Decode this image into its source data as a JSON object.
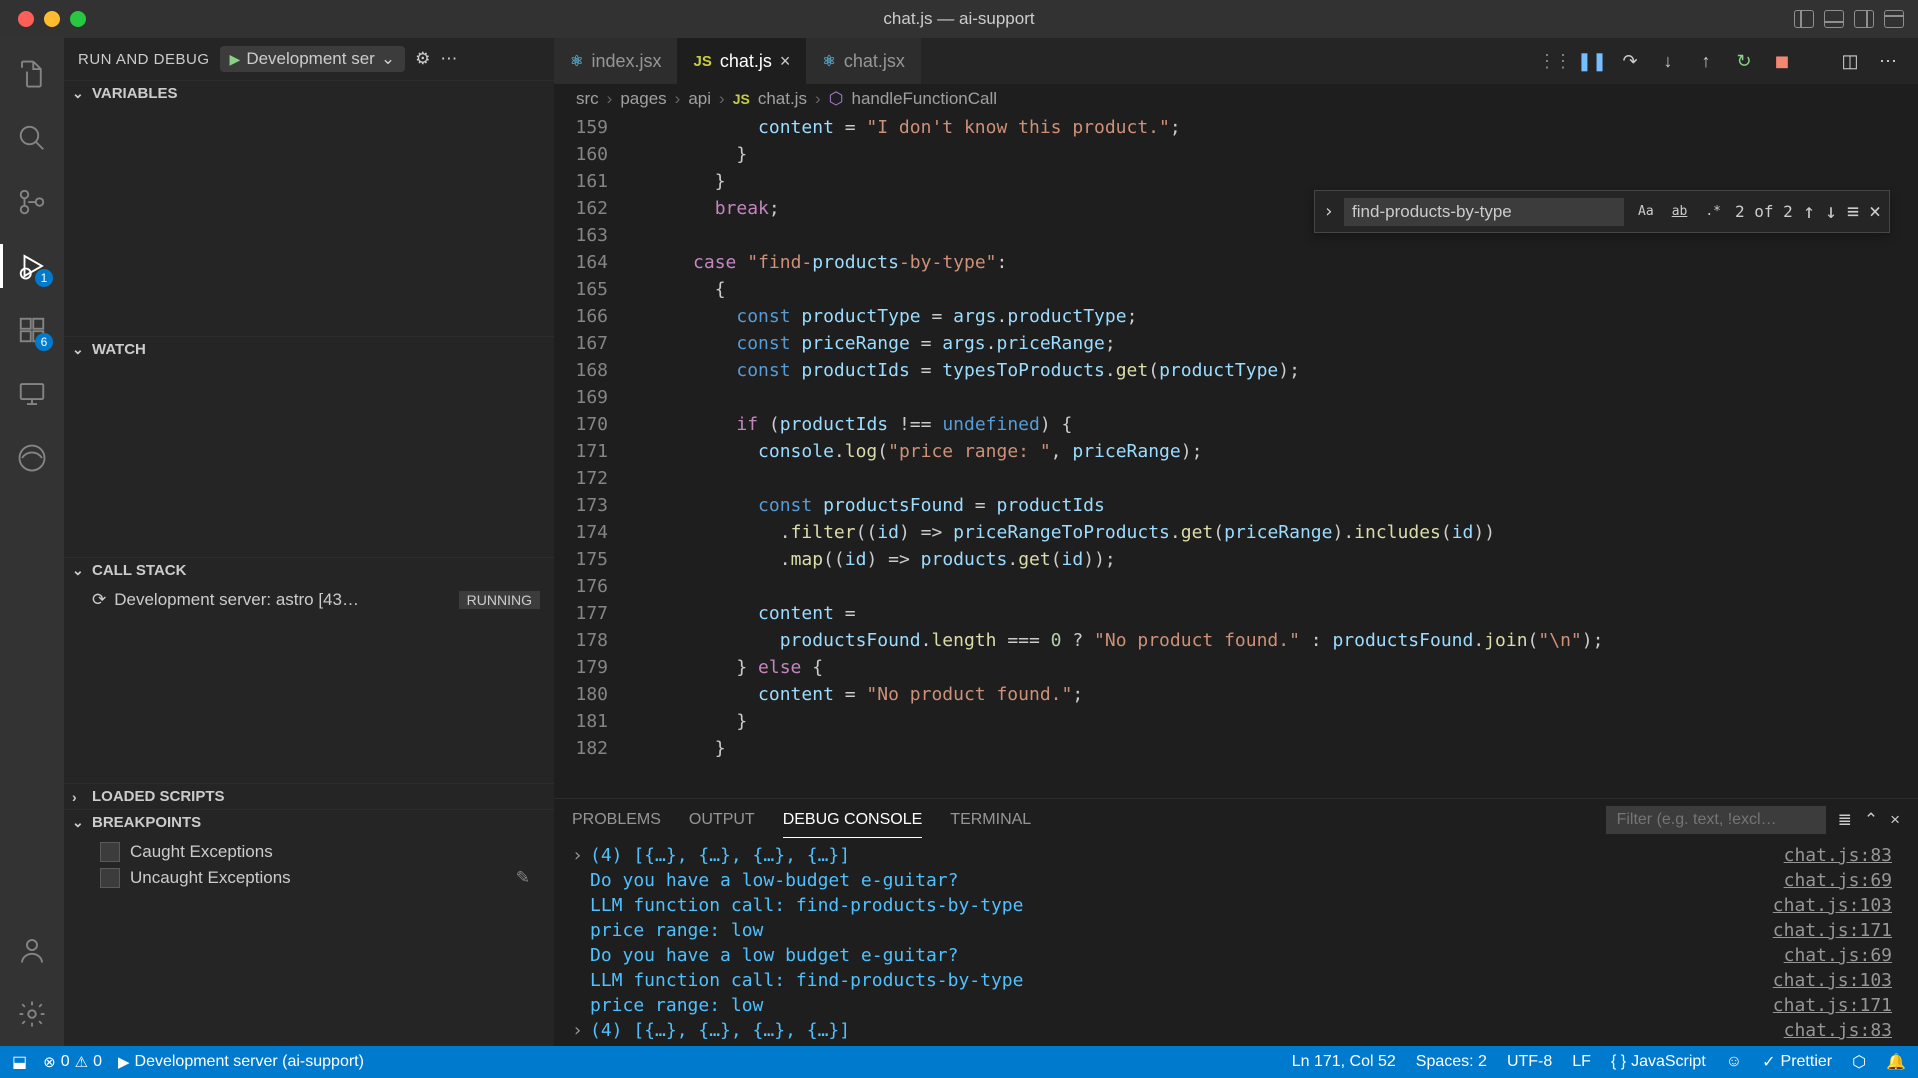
{
  "window": {
    "title": "chat.js — ai-support"
  },
  "sidebar": {
    "title": "RUN AND DEBUG",
    "config": "Development ser",
    "sections": {
      "variables": "VARIABLES",
      "watch": "WATCH",
      "callstack": "CALL STACK",
      "loaded": "LOADED SCRIPTS",
      "breakpoints": "BREAKPOINTS"
    },
    "callstackItem": "Development server: astro [43…",
    "callstackStatus": "RUNNING",
    "bp1": "Caught Exceptions",
    "bp2": "Uncaught Exceptions"
  },
  "activity": {
    "debugBadge": "1",
    "extBadge": "6"
  },
  "tabs": {
    "t1": "index.jsx",
    "t2": "chat.js",
    "t3": "chat.jsx"
  },
  "breadcrumbs": {
    "p1": "src",
    "p2": "pages",
    "p3": "api",
    "p4": "chat.js",
    "p5": "handleFunctionCall"
  },
  "search": {
    "value": "find-products-by-type",
    "count": "2 of 2"
  },
  "code": {
    "lines": [
      {
        "n": "159",
        "t": "            content = \"I don't know this product.\";",
        "cls": ""
      },
      {
        "n": "160",
        "t": "          }",
        "cls": ""
      },
      {
        "n": "161",
        "t": "        }",
        "cls": ""
      },
      {
        "n": "162",
        "t": "        break;",
        "cls": ""
      },
      {
        "n": "163",
        "t": "",
        "cls": ""
      },
      {
        "n": "164",
        "t": "      case \"find-products-by-type\":",
        "cls": ""
      },
      {
        "n": "165",
        "t": "        {",
        "cls": ""
      },
      {
        "n": "166",
        "t": "          const productType = args.productType;",
        "cls": ""
      },
      {
        "n": "167",
        "t": "          const priceRange = args.priceRange;",
        "cls": ""
      },
      {
        "n": "168",
        "t": "          const productIds = typesToProducts.get(productType);",
        "cls": ""
      },
      {
        "n": "169",
        "t": "",
        "cls": ""
      },
      {
        "n": "170",
        "t": "          if (productIds !== undefined) {",
        "cls": ""
      },
      {
        "n": "171",
        "t": "            console.log(\"price range: \", priceRange);",
        "cls": ""
      },
      {
        "n": "172",
        "t": "",
        "cls": ""
      },
      {
        "n": "173",
        "t": "            const productsFound = productIds",
        "cls": ""
      },
      {
        "n": "174",
        "t": "              .filter((id) => priceRangeToProducts.get(priceRange).includes(id))",
        "cls": ""
      },
      {
        "n": "175",
        "t": "              .map((id) => products.get(id));",
        "cls": ""
      },
      {
        "n": "176",
        "t": "",
        "cls": ""
      },
      {
        "n": "177",
        "t": "            content =",
        "cls": ""
      },
      {
        "n": "178",
        "t": "              productsFound.length === 0 ? \"No product found.\" : productsFound.join(\"\\n\");",
        "cls": ""
      },
      {
        "n": "179",
        "t": "          } else {",
        "cls": ""
      },
      {
        "n": "180",
        "t": "            content = \"No product found.\";",
        "cls": ""
      },
      {
        "n": "181",
        "t": "          }",
        "cls": ""
      },
      {
        "n": "182",
        "t": "        }",
        "cls": ""
      }
    ]
  },
  "panel": {
    "tabs": {
      "problems": "PROBLEMS",
      "output": "OUTPUT",
      "console": "DEBUG CONSOLE",
      "terminal": "TERMINAL"
    },
    "filterPlaceholder": "Filter (e.g. text, !excl…",
    "lines": [
      {
        "exp": "›",
        "msg": "(4) [{…}, {…}, {…}, {…}]",
        "src": "chat.js:83",
        "cls": "c-blue"
      },
      {
        "exp": "",
        "msg": "Do you have a low-budget e-guitar?",
        "src": "chat.js:69",
        "cls": "c-blue"
      },
      {
        "exp": "",
        "msg": "LLM function call:  find-products-by-type",
        "src": "chat.js:103",
        "cls": "c-blue"
      },
      {
        "exp": "",
        "msg": "price range:  low",
        "src": "chat.js:171",
        "cls": "c-blue"
      },
      {
        "exp": "",
        "msg": "Do you have a low budget e-guitar?",
        "src": "chat.js:69",
        "cls": "c-blue"
      },
      {
        "exp": "",
        "msg": "LLM function call:  find-products-by-type",
        "src": "chat.js:103",
        "cls": "c-blue"
      },
      {
        "exp": "",
        "msg": "price range:  low",
        "src": "chat.js:171",
        "cls": "c-blue"
      },
      {
        "exp": "›",
        "msg": "(4) [{…}, {…}, {…}, {…}]",
        "src": "chat.js:83",
        "cls": "c-blue"
      }
    ]
  },
  "statusbar": {
    "errors": "0",
    "warnings": "0",
    "server": "Development server (ai-support)",
    "cursor": "Ln 171, Col 52",
    "spaces": "Spaces: 2",
    "encoding": "UTF-8",
    "eol": "LF",
    "lang": "JavaScript",
    "prettier": "Prettier"
  }
}
